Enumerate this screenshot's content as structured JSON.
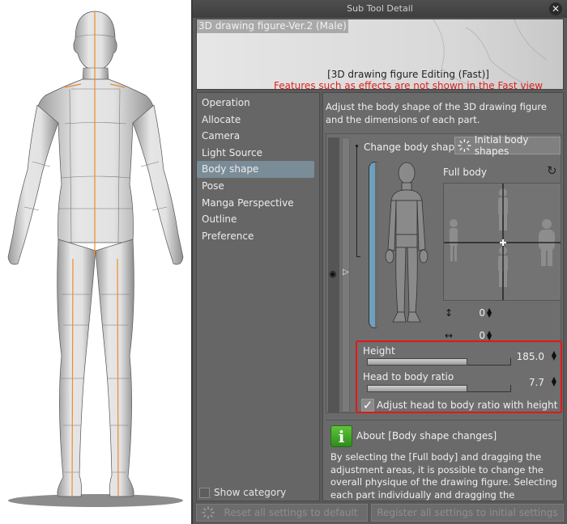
{
  "dialog": {
    "title": "Sub Tool Detail",
    "close_icon": "close-icon"
  },
  "preview": {
    "figure_name": "3D drawing figure-Ver.2 (Male)",
    "mode_text": "[3D drawing figure Editing (Fast)]",
    "warning_text": "Features such as effects are not shown in the Fast view",
    "warning_color": "#e0201e"
  },
  "categories": {
    "items": [
      {
        "label": "Operation"
      },
      {
        "label": "Allocate"
      },
      {
        "label": "Camera"
      },
      {
        "label": "Light Source"
      },
      {
        "label": "Body shape",
        "selected": true
      },
      {
        "label": "Pose"
      },
      {
        "label": "Manga Perspective"
      },
      {
        "label": "Outline"
      },
      {
        "label": "Preference"
      }
    ],
    "show_category_label": "Show category",
    "show_category_checked": false,
    "selected_color": "#7a8c98"
  },
  "main": {
    "description": "Adjust the body shape of the 3D drawing figure and the dimensions of each part.",
    "change_body_shape_label": "Change body shape",
    "initial_body_shapes_label": "Initial body shapes",
    "full_body_label": "Full body",
    "vertical_value": "0",
    "horizontal_value": "0",
    "icons": {
      "eye": "eye-icon",
      "play": "triangle-right-icon",
      "reset": "rotate-reset-icon",
      "vertical": "vertical-arrow-icon",
      "horizontal": "horizontal-arrow-icon"
    }
  },
  "params": {
    "height_label": "Height",
    "height_value": "185.0",
    "height_fraction": 0.7,
    "ratio_label": "Head to body ratio",
    "ratio_value": "7.7",
    "ratio_fraction": 0.7,
    "adjust_label": "Adjust head to body ratio with height",
    "adjust_checked": true,
    "highlight_color": "#e51616"
  },
  "about": {
    "title": "About [Body shape changes]",
    "text": "By selecting the [Full body] and dragging the adjustment areas, it is possible to change the overall physique of the drawing figure. Selecting each part individually and dragging the respective adjustment area, allows to change the width and length of diffe"
  },
  "footer": {
    "reset_label": "Reset all settings to default",
    "register_label": "Register all settings to initial settings"
  },
  "accent": {
    "height_bar": "#6ea0be",
    "info_green": "#3fa82a",
    "figure_centerline": "#f08a30"
  }
}
